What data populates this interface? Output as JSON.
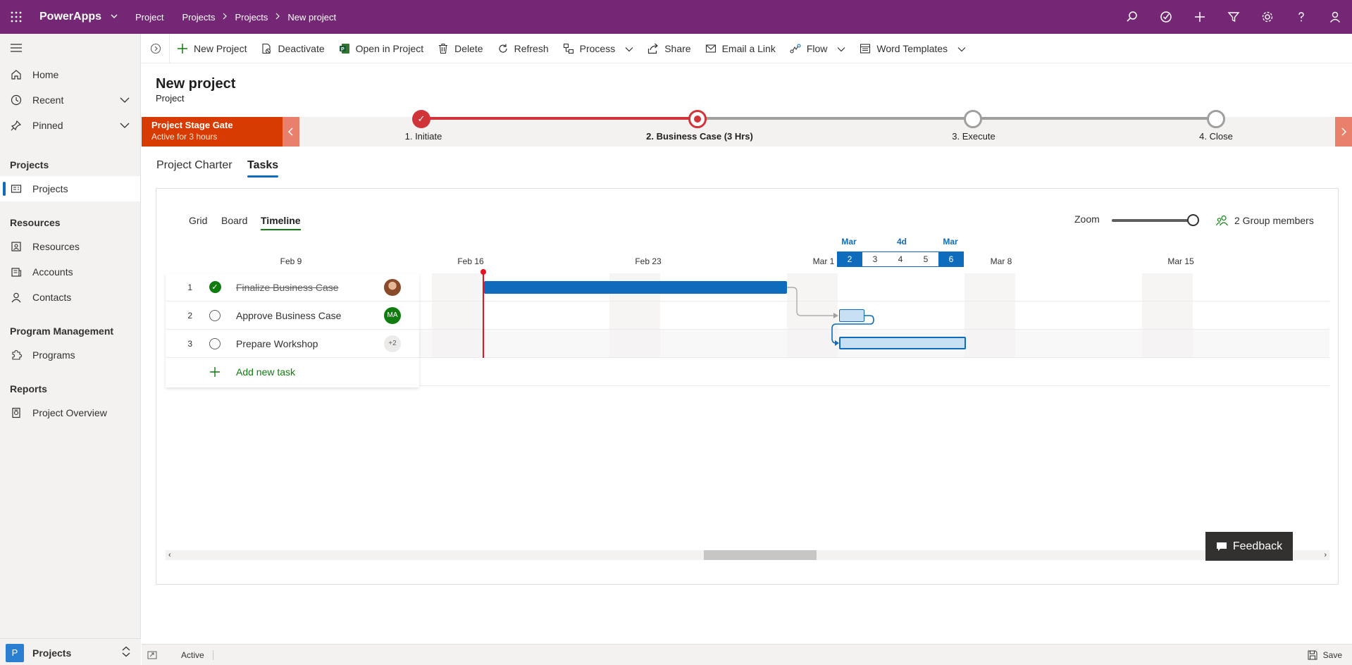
{
  "topbar": {
    "app_name": "PowerApps",
    "area": "Project",
    "breadcrumbs": [
      "Projects",
      "Projects",
      "New project"
    ],
    "right_icons": [
      "search-icon",
      "assistant-icon",
      "plus-icon",
      "filter-icon",
      "gear-icon",
      "help-icon",
      "user-icon"
    ]
  },
  "sidebar": {
    "top_items": [
      {
        "label": "Home",
        "icon": "home-icon"
      },
      {
        "label": "Recent",
        "icon": "clock-icon"
      },
      {
        "label": "Pinned",
        "icon": "pin-icon"
      }
    ],
    "groups": [
      {
        "title": "Projects",
        "items": [
          {
            "label": "Projects",
            "icon": "projects-icon",
            "active": true
          }
        ]
      },
      {
        "title": "Resources",
        "items": [
          {
            "label": "Resources",
            "icon": "resources-icon"
          },
          {
            "label": "Accounts",
            "icon": "accounts-icon"
          },
          {
            "label": "Contacts",
            "icon": "contact-icon"
          }
        ]
      },
      {
        "title": "Program Management",
        "items": [
          {
            "label": "Programs",
            "icon": "puzzle-icon"
          }
        ]
      },
      {
        "title": "Reports",
        "items": [
          {
            "label": "Project Overview",
            "icon": "report-icon"
          }
        ]
      }
    ],
    "area_switcher": {
      "badge": "P",
      "label": "Projects"
    }
  },
  "commands": [
    {
      "label": "New Project",
      "icon": "plus-icon"
    },
    {
      "label": "Deactivate",
      "icon": "deactivate-icon"
    },
    {
      "label": "Open in Project",
      "icon": "project-app-icon"
    },
    {
      "label": "Delete",
      "icon": "trash-icon"
    },
    {
      "label": "Refresh",
      "icon": "refresh-icon"
    },
    {
      "label": "Process",
      "icon": "process-icon",
      "dropdown": true
    },
    {
      "label": "Share",
      "icon": "share-icon"
    },
    {
      "label": "Email a Link",
      "icon": "email-icon"
    },
    {
      "label": "Flow",
      "icon": "flow-icon",
      "dropdown": true
    },
    {
      "label": "Word Templates",
      "icon": "word-icon",
      "dropdown": true
    }
  ],
  "record": {
    "title": "New project",
    "entity": "Project"
  },
  "bpf": {
    "gate_title": "Project Stage Gate",
    "gate_status": "Active for 3 hours",
    "stages": [
      {
        "label": "1. Initiate",
        "state": "done"
      },
      {
        "label": "2. Business Case  (3 Hrs)",
        "state": "active"
      },
      {
        "label": "3. Execute",
        "state": "future"
      },
      {
        "label": "4. Close",
        "state": "future"
      }
    ],
    "accent": "#d13438"
  },
  "tabs": [
    {
      "label": "Project Charter"
    },
    {
      "label": "Tasks",
      "selected": true
    }
  ],
  "tasks": {
    "views": [
      "Grid",
      "Board",
      "Timeline"
    ],
    "selected_view": "Timeline",
    "zoom_label": "Zoom",
    "zoom_level": 1.0,
    "members": "2 Group members",
    "dates": [
      "Feb 9",
      "Feb 16",
      "Feb 23",
      "Mar 1",
      "Mar 8",
      "Mar 15"
    ],
    "selection_header": {
      "left": "Mar",
      "center": "4d",
      "right": "Mar"
    },
    "selection_days": [
      "2",
      "3",
      "4",
      "5",
      "6"
    ],
    "rows": [
      {
        "num": "1",
        "name": "Finalize Business Case",
        "done": true,
        "assignee": "photo"
      },
      {
        "num": "2",
        "name": "Approve Business Case",
        "done": false,
        "assignee": "MA"
      },
      {
        "num": "3",
        "name": "Prepare Workshop",
        "done": false,
        "assignee": "+2"
      }
    ],
    "add_task": "Add new task"
  },
  "feedback": "Feedback",
  "status": {
    "state": "Active",
    "save": "Save"
  },
  "colors": {
    "brand": "#742774",
    "primary": "#0f6cbd",
    "success": "#107c10",
    "today": "#e81123"
  }
}
